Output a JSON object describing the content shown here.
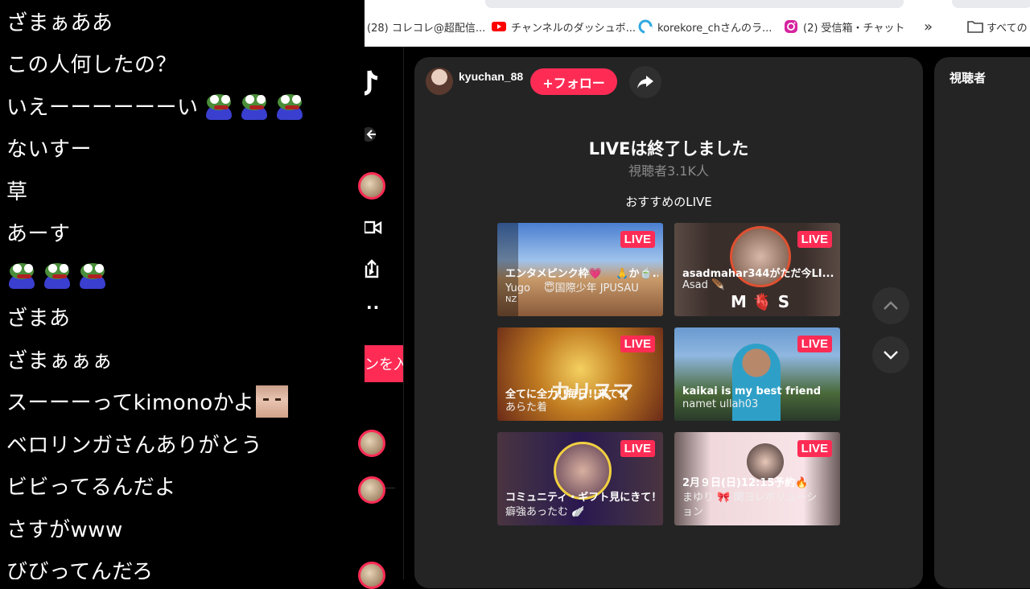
{
  "chat": {
    "messages": [
      {
        "text": "ざまぁああ"
      },
      {
        "text": "この人何したの？"
      },
      {
        "text": "いえーーーーーーい",
        "frogs": 3
      },
      {
        "text": "ないすー"
      },
      {
        "text": "草"
      },
      {
        "text": "あーす"
      },
      {
        "text": "",
        "frogs": 3
      },
      {
        "text": "ざまあ"
      },
      {
        "text": "ざまぁぁぁ"
      },
      {
        "text": "スーーーってkimonoかよ",
        "face": true
      },
      {
        "text": "ベロリンガさんありがとう"
      },
      {
        "text": "ビビってるんだよ"
      },
      {
        "text": "さすがwww"
      },
      {
        "text": "びびってんだろ"
      }
    ]
  },
  "bookmarks": [
    {
      "label": "(28) コレコレ@超配信...",
      "icon": "niconico-icon",
      "color": "#666"
    },
    {
      "label": "チャンネルのダッシュボ...",
      "icon": "youtube-icon",
      "color": "#ff0000"
    },
    {
      "label": "korekore_chさんのラ...",
      "icon": "twitcasting-icon",
      "color": "#2fa8e0"
    },
    {
      "label": "(2) 受信箱・チャット",
      "icon": "instagram-icon",
      "color": "#d6249f"
    },
    {
      "label": "»",
      "icon": "more-icon",
      "color": "#333"
    },
    {
      "label": "すべての",
      "icon": "folder-icon",
      "color": "#444"
    }
  ],
  "rail": {
    "join_label": "ンを入"
  },
  "player": {
    "username": "kyuchan_88",
    "follow_label": "+フォロー",
    "ended_title": "LIVEは終了しました",
    "viewers": "視聴者3.1K人",
    "recommended_title": "おすすめのLIVE",
    "cards": [
      {
        "badge": "LIVE",
        "title": "エンタメピンク枠💗 　🙏か🍵...",
        "name": "Yugo 　😇国際少年 JPUSAU",
        "extra": "NZ"
      },
      {
        "badge": "LIVE",
        "title": "asadmahar344がただ今LI...",
        "name": "Asad 🪶",
        "overlay": "M 🫀 S"
      },
      {
        "badge": "LIVE",
        "title": "全てに全力!!毎日!!来て!!",
        "name": "あらた着",
        "overlay": "カリスマ"
      },
      {
        "badge": "LIVE",
        "title": "kaikai is my best friend",
        "name": "namet ullah03"
      },
      {
        "badge": "LIVE",
        "title": "コミュニティ・ギフト見にきて！！",
        "name": "癖強あったむ 🪽"
      },
      {
        "badge": "LIVE",
        "title": "2月９日(日)12:15予約🔥",
        "name": "まゆり 🎀 関ヨレボリューシ",
        "extra": "ョン"
      }
    ]
  },
  "viewers_panel": {
    "title": "視聴者"
  },
  "colors": {
    "accent": "#fe2c55",
    "panel": "#242424"
  }
}
